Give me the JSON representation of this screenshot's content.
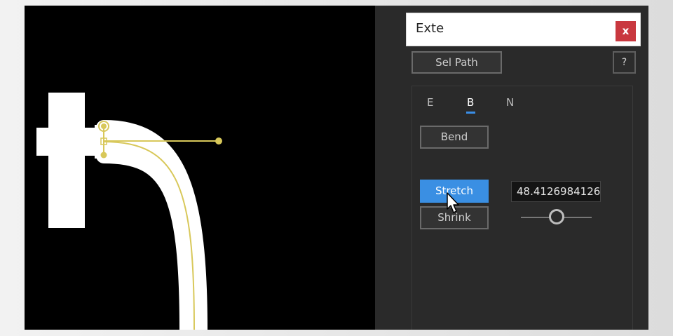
{
  "window": {
    "title": "Exte",
    "close_label": "x"
  },
  "toolbar": {
    "sel_path_label": "Sel Path",
    "help_label": "?"
  },
  "tabs": [
    {
      "label": "E",
      "active": false
    },
    {
      "label": "B",
      "active": true
    },
    {
      "label": "N",
      "active": false
    }
  ],
  "buttons": {
    "bend_label": "Bend",
    "stretch_label": "Stretch",
    "shrink_label": "Shrink"
  },
  "stretch_value": "48.4126984126",
  "slider_value": 0.5,
  "colors": {
    "accent": "#3a8fe3",
    "close": "#c9383f",
    "path_handle": "#d8c85a",
    "shape_fill": "#ffffff",
    "canvas": "#000000",
    "panel": "#2a2a2a"
  },
  "icons": [
    "close-icon",
    "mouse-pointer-icon",
    "bezier-handle-icon"
  ]
}
